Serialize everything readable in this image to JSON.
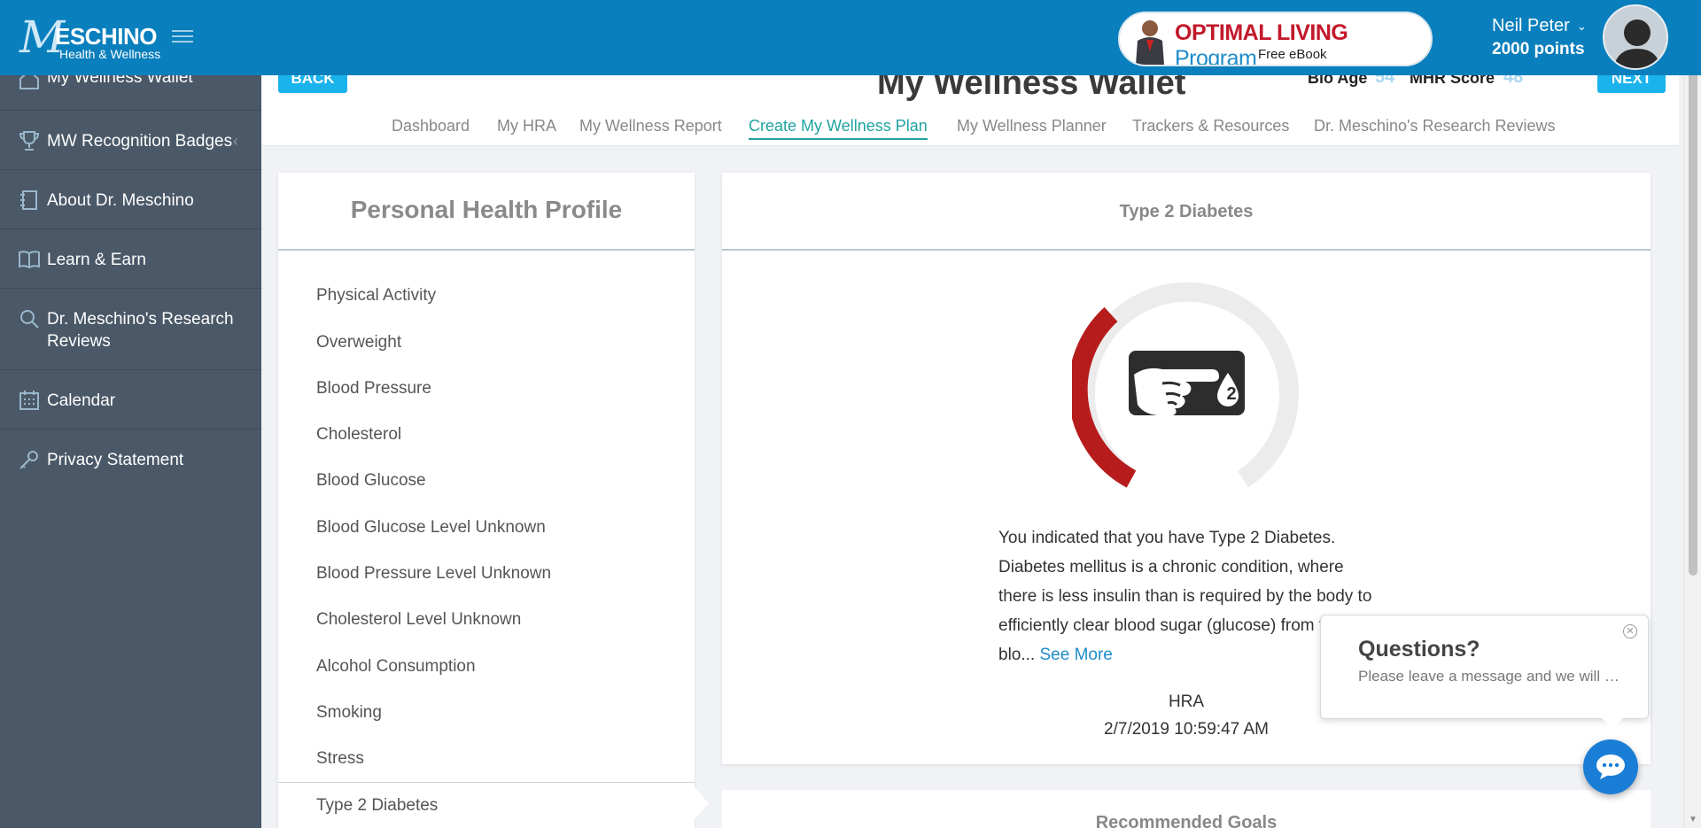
{
  "brand": {
    "logo_letter": "M",
    "logo_text": "ESCHINO",
    "logo_sub": "Health & Wellness"
  },
  "promo": {
    "title_red": "OPTIMAL LIVING",
    "title_blue": "Program",
    "subtitle": "Free eBook"
  },
  "user": {
    "name": "Neil Peter",
    "points": "2000 points"
  },
  "sidebar": {
    "items": [
      {
        "label": "My Wellness Wallet"
      },
      {
        "label": "MW Recognition Badges"
      },
      {
        "label": "About Dr. Meschino"
      },
      {
        "label": "Learn & Earn"
      },
      {
        "label": "Dr. Meschino's Research Reviews"
      },
      {
        "label": "Calendar"
      },
      {
        "label": "Privacy Statement"
      }
    ],
    "research_line1": "Dr. Meschino's Research",
    "research_line2": "Reviews"
  },
  "header": {
    "back": "BACK",
    "next": "NEXT",
    "title": "My Wellness Wallet",
    "bio_age_label": "Bio Age",
    "bio_age_value": "54",
    "mhr_label": "MHR Score",
    "mhr_value": "48"
  },
  "tabs": [
    {
      "label": "Dashboard"
    },
    {
      "label": "My HRA"
    },
    {
      "label": "My Wellness Report"
    },
    {
      "label": "Create My Wellness Plan",
      "active": true
    },
    {
      "label": "My Wellness Planner"
    },
    {
      "label": "Trackers & Resources"
    },
    {
      "label": "Dr. Meschino's Research Reviews"
    }
  ],
  "profile": {
    "title": "Personal Health Profile",
    "items": [
      "Physical Activity",
      "Overweight",
      "Blood Pressure",
      "Cholesterol",
      "Blood Glucose",
      "Blood Glucose Level Unknown",
      "Blood Pressure Level Unknown",
      "Cholesterol Level Unknown",
      "Alcohol Consumption",
      "Smoking",
      "Stress",
      "Type 2 Diabetes"
    ],
    "selected": "Type 2 Diabetes"
  },
  "detail": {
    "title": "Type 2 Diabetes",
    "gauge_icon": "finger-blood-drop-icon",
    "gauge_badge": "2",
    "gauge_color": "#b71c1c",
    "description": "You indicated that you have Type 2 Diabetes. Diabetes mellitus is a chronic condition, where there is less insulin than is required by the body to efficiently clear blood sugar (glucose) from the blo...",
    "see_more": "See More",
    "source": "HRA",
    "date": "2/7/2019 10:59:47 AM"
  },
  "recommended": {
    "title": "Recommended Goals"
  },
  "chat": {
    "title": "Questions?",
    "message": "Please leave a message and we will …"
  },
  "colors": {
    "topbar": "#0a7fbd",
    "sidebar": "#4a5867",
    "accent": "#1fa3a0",
    "button": "#1ab3ec"
  }
}
